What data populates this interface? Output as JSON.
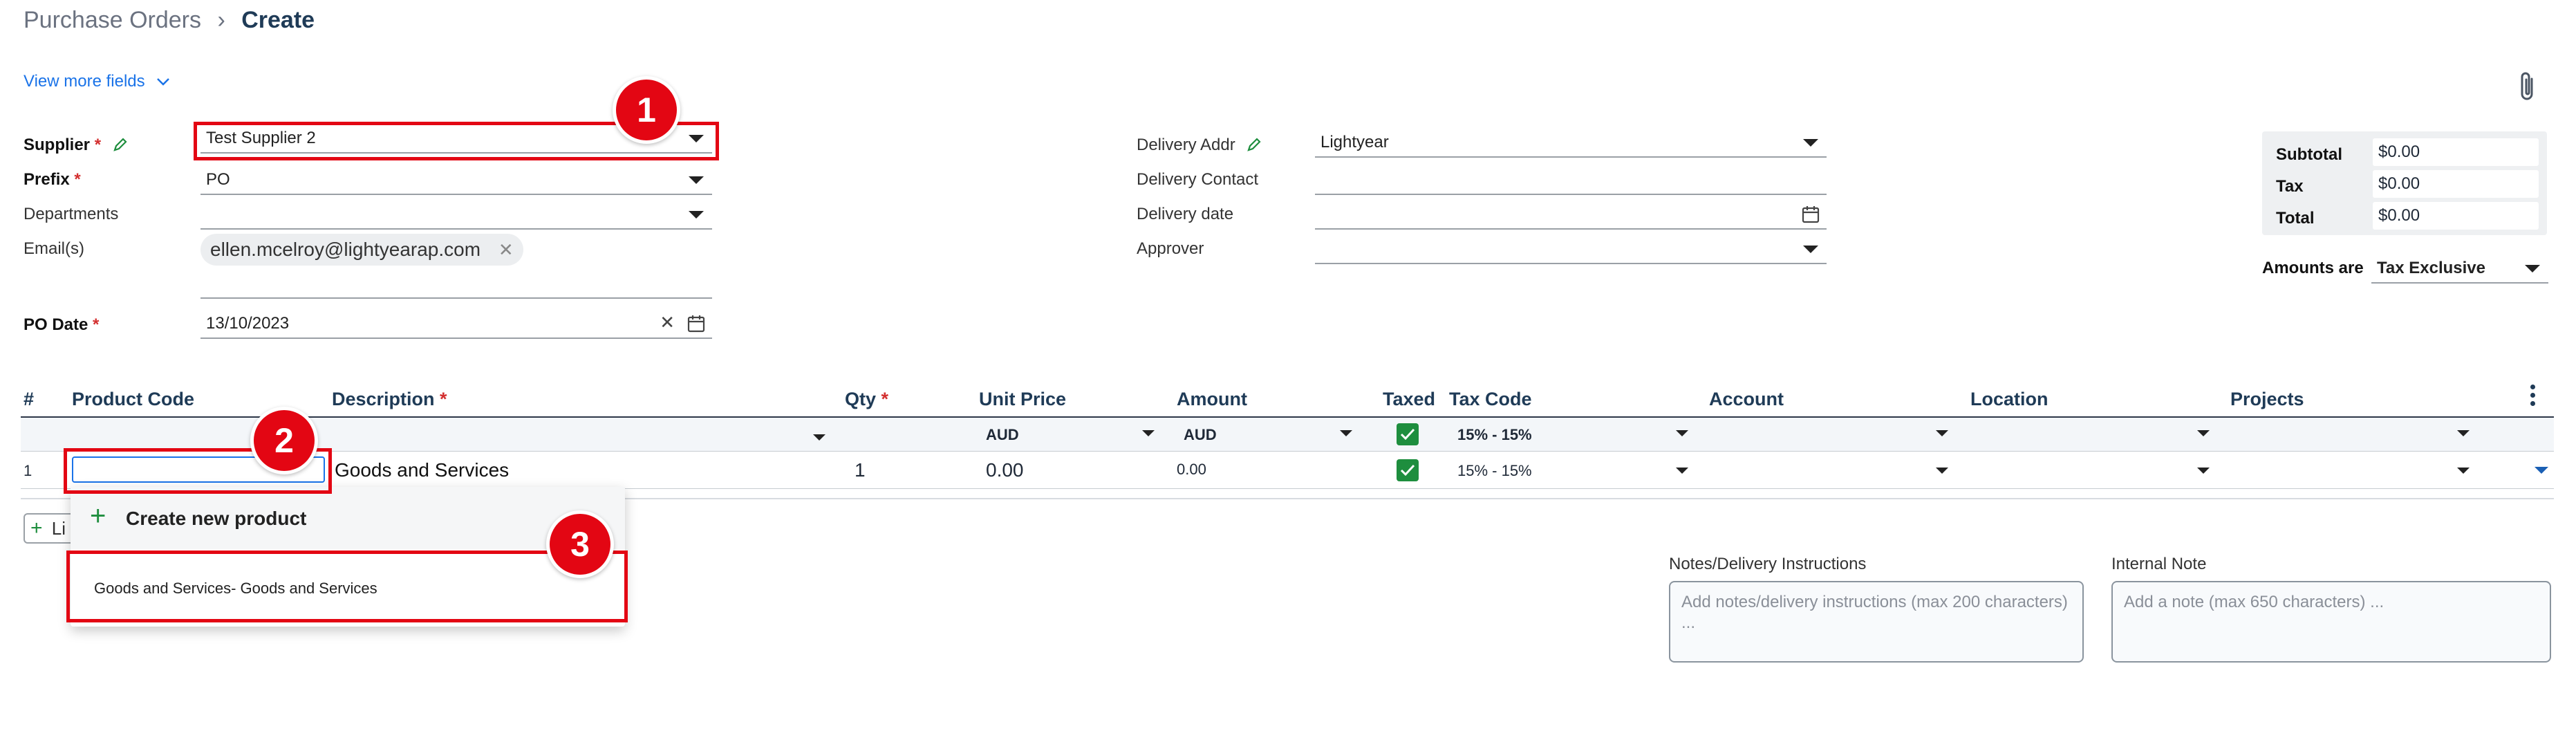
{
  "breadcrumb": {
    "parent": "Purchase Orders",
    "current": "Create"
  },
  "view_more": "View more fields",
  "form": {
    "supplier_label": "Supplier",
    "supplier_value": "Test Supplier 2",
    "prefix_label": "Prefix",
    "prefix_value": "PO",
    "departments_label": "Departments",
    "emails_label": "Email(s)",
    "email_chip": "ellen.mcelroy@lightyearap.com",
    "po_date_label": "PO Date",
    "po_date_value": "13/10/2023",
    "required_mark": "*",
    "delivery_addr_label": "Delivery Addr",
    "delivery_addr_value": "Lightyear",
    "delivery_contact_label": "Delivery Contact",
    "delivery_date_label": "Delivery date",
    "approver_label": "Approver"
  },
  "totals": {
    "subtotal_label": "Subtotal",
    "subtotal": "$0.00",
    "tax_label": "Tax",
    "tax": "$0.00",
    "total_label": "Total",
    "total": "$0.00",
    "amounts_are_label": "Amounts are",
    "amounts_are_value": "Tax Exclusive"
  },
  "table": {
    "headers": {
      "num": "#",
      "product_code": "Product Code",
      "description": "Description",
      "qty": "Qty",
      "unit_price": "Unit Price",
      "amount": "Amount",
      "taxed": "Taxed",
      "tax_code": "Tax Code",
      "account": "Account",
      "location": "Location",
      "projects": "Projects"
    },
    "defaults": {
      "unit_price_currency": "AUD",
      "amount_currency": "AUD",
      "tax_code": "15% - 15%"
    },
    "row": {
      "num": "1",
      "product_code": "",
      "description": "Goods and Services",
      "qty": "1",
      "unit_price": "0.00",
      "amount": "0.00",
      "tax_code": "15% - 15%"
    },
    "add_line_partial": "Li"
  },
  "dropdown": {
    "create_new": "Create new product",
    "option": "Goods and Services- Goods and Services"
  },
  "notes": {
    "notes_label": "Notes/Delivery Instructions",
    "notes_placeholder": "Add notes/delivery instructions (max 200 characters) ...",
    "internal_label": "Internal Note",
    "internal_placeholder": "Add a note (max 650 characters) ..."
  },
  "annotations": {
    "step1": "1",
    "step2": "2",
    "step3": "3"
  },
  "colors": {
    "accent": "#1a73e8",
    "heading": "#1f3b57",
    "check": "#1e8e3e",
    "annotation": "#e30613",
    "required": "#d32f2f"
  }
}
